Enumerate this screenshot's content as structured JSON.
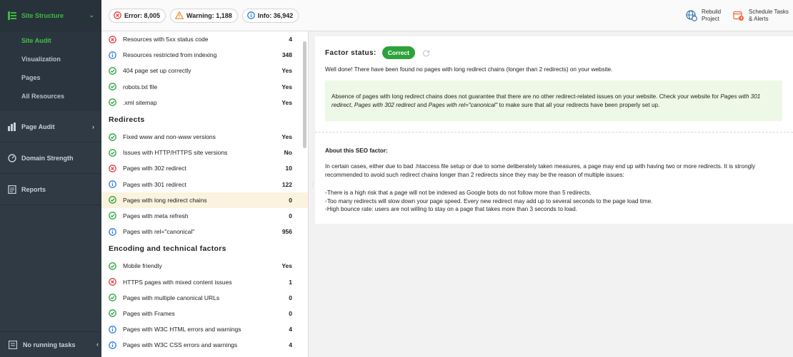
{
  "nav": {
    "site_structure": "Site Structure",
    "subitems": [
      "Site Audit",
      "Visualization",
      "Pages",
      "All Resources"
    ],
    "page_audit": "Page Audit",
    "domain_strength": "Domain Strength",
    "reports": "Reports",
    "no_running_tasks": "No running tasks"
  },
  "topbar": {
    "error": "Error: 8,005",
    "warning": "Warning: 1,188",
    "info": "Info: 36,942",
    "rebuild_line1": "Rebuild",
    "rebuild_line2": "Project",
    "schedule_line1": "Schedule Tasks",
    "schedule_line2": "& Alerts"
  },
  "list": {
    "rows_top": [
      {
        "icon": "error",
        "label": "Resources with 5xx status code",
        "value": "4"
      },
      {
        "icon": "info",
        "label": "Resources restricted from indexing",
        "value": "348"
      },
      {
        "icon": "ok",
        "label": "404 page set up correctly",
        "value": "Yes"
      },
      {
        "icon": "ok",
        "label": "robots.txt file",
        "value": "Yes"
      },
      {
        "icon": "ok",
        "label": ".xml sitemap",
        "value": "Yes"
      }
    ],
    "group_redirects": "Redirects",
    "rows_redirects": [
      {
        "icon": "ok",
        "label": "Fixed www and non-www versions",
        "value": "Yes"
      },
      {
        "icon": "ok",
        "label": "Issues with HTTP/HTTPS site versions",
        "value": "No"
      },
      {
        "icon": "error",
        "label": "Pages with 302 redirect",
        "value": "10"
      },
      {
        "icon": "info",
        "label": "Pages with 301 redirect",
        "value": "122"
      },
      {
        "icon": "ok",
        "label": "Pages with long redirect chains",
        "value": "0"
      },
      {
        "icon": "ok",
        "label": "Pages with meta refresh",
        "value": "0"
      },
      {
        "icon": "info",
        "label": "Pages with rel=\"canonical\"",
        "value": "956"
      }
    ],
    "group_encoding": "Encoding and technical factors",
    "rows_encoding": [
      {
        "icon": "ok",
        "label": "Mobile friendly",
        "value": "Yes"
      },
      {
        "icon": "error",
        "label": "HTTPS pages with mixed content issues",
        "value": "1"
      },
      {
        "icon": "ok",
        "label": "Pages with multiple canonical URLs",
        "value": "0"
      },
      {
        "icon": "ok",
        "label": "Pages with Frames",
        "value": "0"
      },
      {
        "icon": "info",
        "label": "Pages with W3C HTML errors and warnings",
        "value": "4"
      },
      {
        "icon": "info",
        "label": "Pages with W3C CSS errors and warnings",
        "value": "4"
      }
    ]
  },
  "detail": {
    "status_label": "Factor status:",
    "status_value": "Correct",
    "well_done": "Well done! There have been found no pages with long redirect chains (longer than 2 redirects) on your website.",
    "note_a": "Absence of pages with long redirect chains does not guarantee that there are no other redirect-related issues on your website. Check your website for ",
    "note_i1": "Pages with 301 redirect",
    "note_b": ", ",
    "note_i2": "Pages with 302 redirect",
    "note_c": " and ",
    "note_i3": "Pages with rel=\"canonical\"",
    "note_d": " to make sure that all your redirects have been properly set up.",
    "about_title": "About this SEO factor:",
    "about_text": "In certain cases, either due to bad .htaccess file setup or due to some deliberately taken measures, a page may end up with having two or more redirects. It is strongly recommended to avoid such redirect chains longer than 2 redirects since they may be the reason of multiple issues:",
    "bullets": [
      "◦There is a high risk that a page will not be indexed as Google bots do not follow more than 5 redirects.",
      "◦Too many redirects will slow down your page speed. Every new redirect may add up to several seconds to the page load time.",
      "◦High bounce rate: users are not willing to stay on a page that takes more than 3 seconds to load."
    ]
  },
  "colors": {
    "ok": "#2ea23a",
    "error": "#e0403a",
    "info": "#2b7fd6",
    "warning": "#f08a24",
    "selected_row": "#fbf3de"
  }
}
